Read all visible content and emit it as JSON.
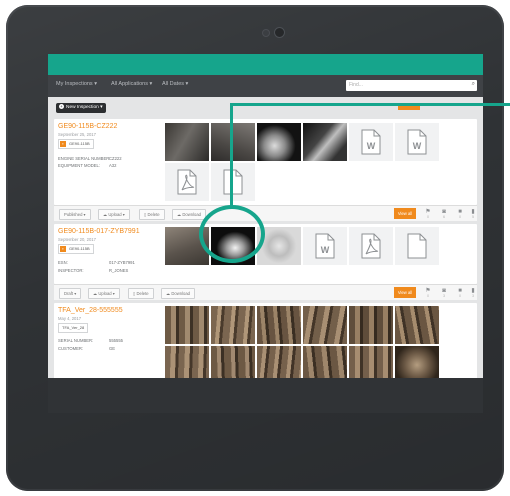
{
  "nav": {
    "my_inspections": "My Inspections ▾",
    "all_applications": "All Applications ▾",
    "all_dates": "All Dates ▾",
    "search_placeholder": "Find..."
  },
  "toolbar_top": {
    "new_inspection": "New Inspection ▾"
  },
  "inspections": [
    {
      "title": "GE90-115B-CZ222",
      "date": "September 25, 2017",
      "tag": "GE90-115B",
      "fields": [
        {
          "key": "ENGINE SERIAL NUMBER:",
          "value": "CZ222"
        },
        {
          "key": "EQUIPMENT MODEL:",
          "value": "A32"
        }
      ],
      "actions": {
        "status": "Published ▾",
        "upload": "Upload ▾",
        "delete": "Delete",
        "download": "Download",
        "view_all": "View all"
      }
    },
    {
      "title": "GE90-115B-017-ZYB7991",
      "date": "September 20, 2017",
      "tag": "GE90-115B",
      "fields": [
        {
          "key": "ESN:",
          "value": "017-ZYB7991"
        },
        {
          "key": "INSPECTOR:",
          "value": "R_JONES"
        }
      ],
      "actions": {
        "status": "Draft ▾",
        "upload": "Upload ▾",
        "delete": "Delete",
        "download": "Download",
        "view_all": "View all"
      }
    },
    {
      "title": "TFA_Ver_28-555555",
      "date": "May 4, 2017",
      "tag": "TFA_Ver_28",
      "fields": [
        {
          "key": "SERIAL NUMBER:",
          "value": "555555"
        },
        {
          "key": "CUSTOMER:",
          "value": "GE"
        }
      ]
    }
  ],
  "colors": {
    "teal": "#16a58c",
    "orange": "#f08a1d",
    "bezel": "#2f3235"
  }
}
